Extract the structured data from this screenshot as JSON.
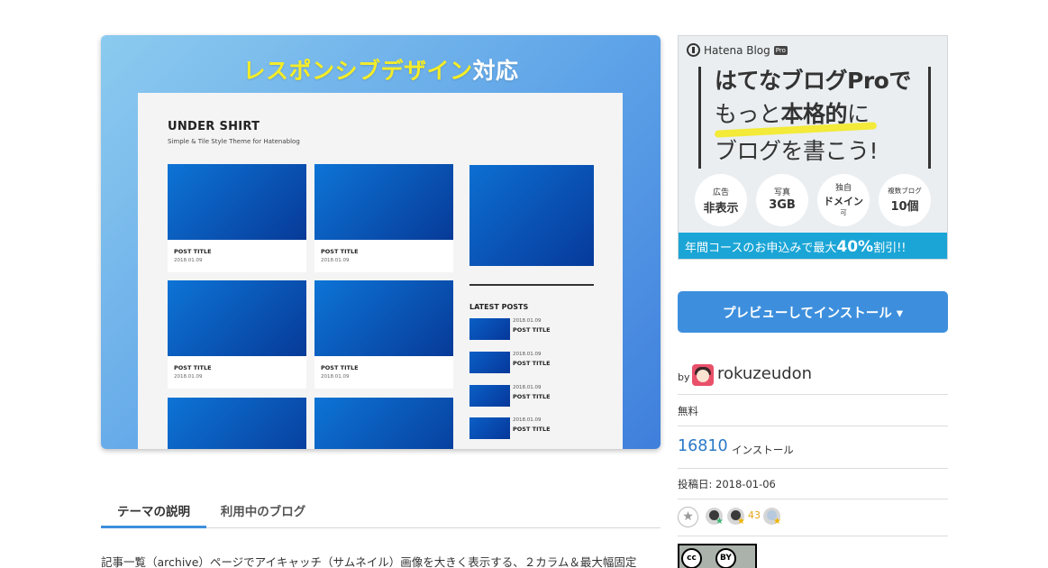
{
  "hero": {
    "headline_yellow": "レスポンシブデザイン",
    "headline_white": "対応",
    "mock": {
      "title": "UNDER SHIRT",
      "subtitle": "Simple & Tile Style Theme for Hatenablog",
      "cards": [
        {
          "title": "POST TITLE",
          "date": "2018.01.09"
        },
        {
          "title": "POST TITLE",
          "date": "2018.01.09"
        },
        {
          "title": "POST TITLE",
          "date": "2018.01.09"
        },
        {
          "title": "POST TITLE",
          "date": "2018.01.09"
        }
      ],
      "latest_heading": "LATEST POSTS",
      "latest": [
        {
          "date": "2018.01.09",
          "title": "POST TITLE"
        },
        {
          "date": "2018.01.09",
          "title": "POST TITLE"
        },
        {
          "date": "2018.01.09",
          "title": "POST TITLE"
        },
        {
          "date": "2018.01.09",
          "title": "POST TITLE"
        }
      ]
    }
  },
  "tabs": [
    {
      "label": "テーマの説明",
      "active": true
    },
    {
      "label": "利用中のブログ",
      "active": false
    }
  ],
  "description": "記事一覧（archive）ページでアイキャッチ（サムネイル）画像を大きく表示する、２カラム＆最大幅固定",
  "ad": {
    "logo": "Hatena Blog",
    "logo_badge": "Pro",
    "line1": "はてなブログProで",
    "line2_pre": "もっと",
    "line2_bold": "本格的",
    "line2_post": "に",
    "line3": "ブログを書こう!",
    "features": [
      {
        "top": "広告",
        "bottom": "非表示"
      },
      {
        "top": "写真",
        "bottom": "3GB"
      },
      {
        "top": "独自",
        "bottom": "ドメイン",
        "note": "可"
      },
      {
        "top": "複数ブログ",
        "bottom": "10個"
      }
    ],
    "footer_pre": "年間コースのお申込みで最大",
    "footer_big": "40%",
    "footer_post": "割引!!"
  },
  "preview_button": "プレビューしてインストール ▾",
  "author": {
    "by": "by",
    "name": "rokuzeudon"
  },
  "price": "無料",
  "installs": {
    "count": "16810",
    "label": "インストール"
  },
  "posted": "投稿日: 2018-01-06",
  "stars": {
    "count": "43"
  },
  "license": {
    "label": "BY"
  },
  "colors": {
    "accent": "#3d8fdd",
    "link": "#2a79c8",
    "ad_footer": "#1ba5d6",
    "highlight": "#f3ea39"
  }
}
